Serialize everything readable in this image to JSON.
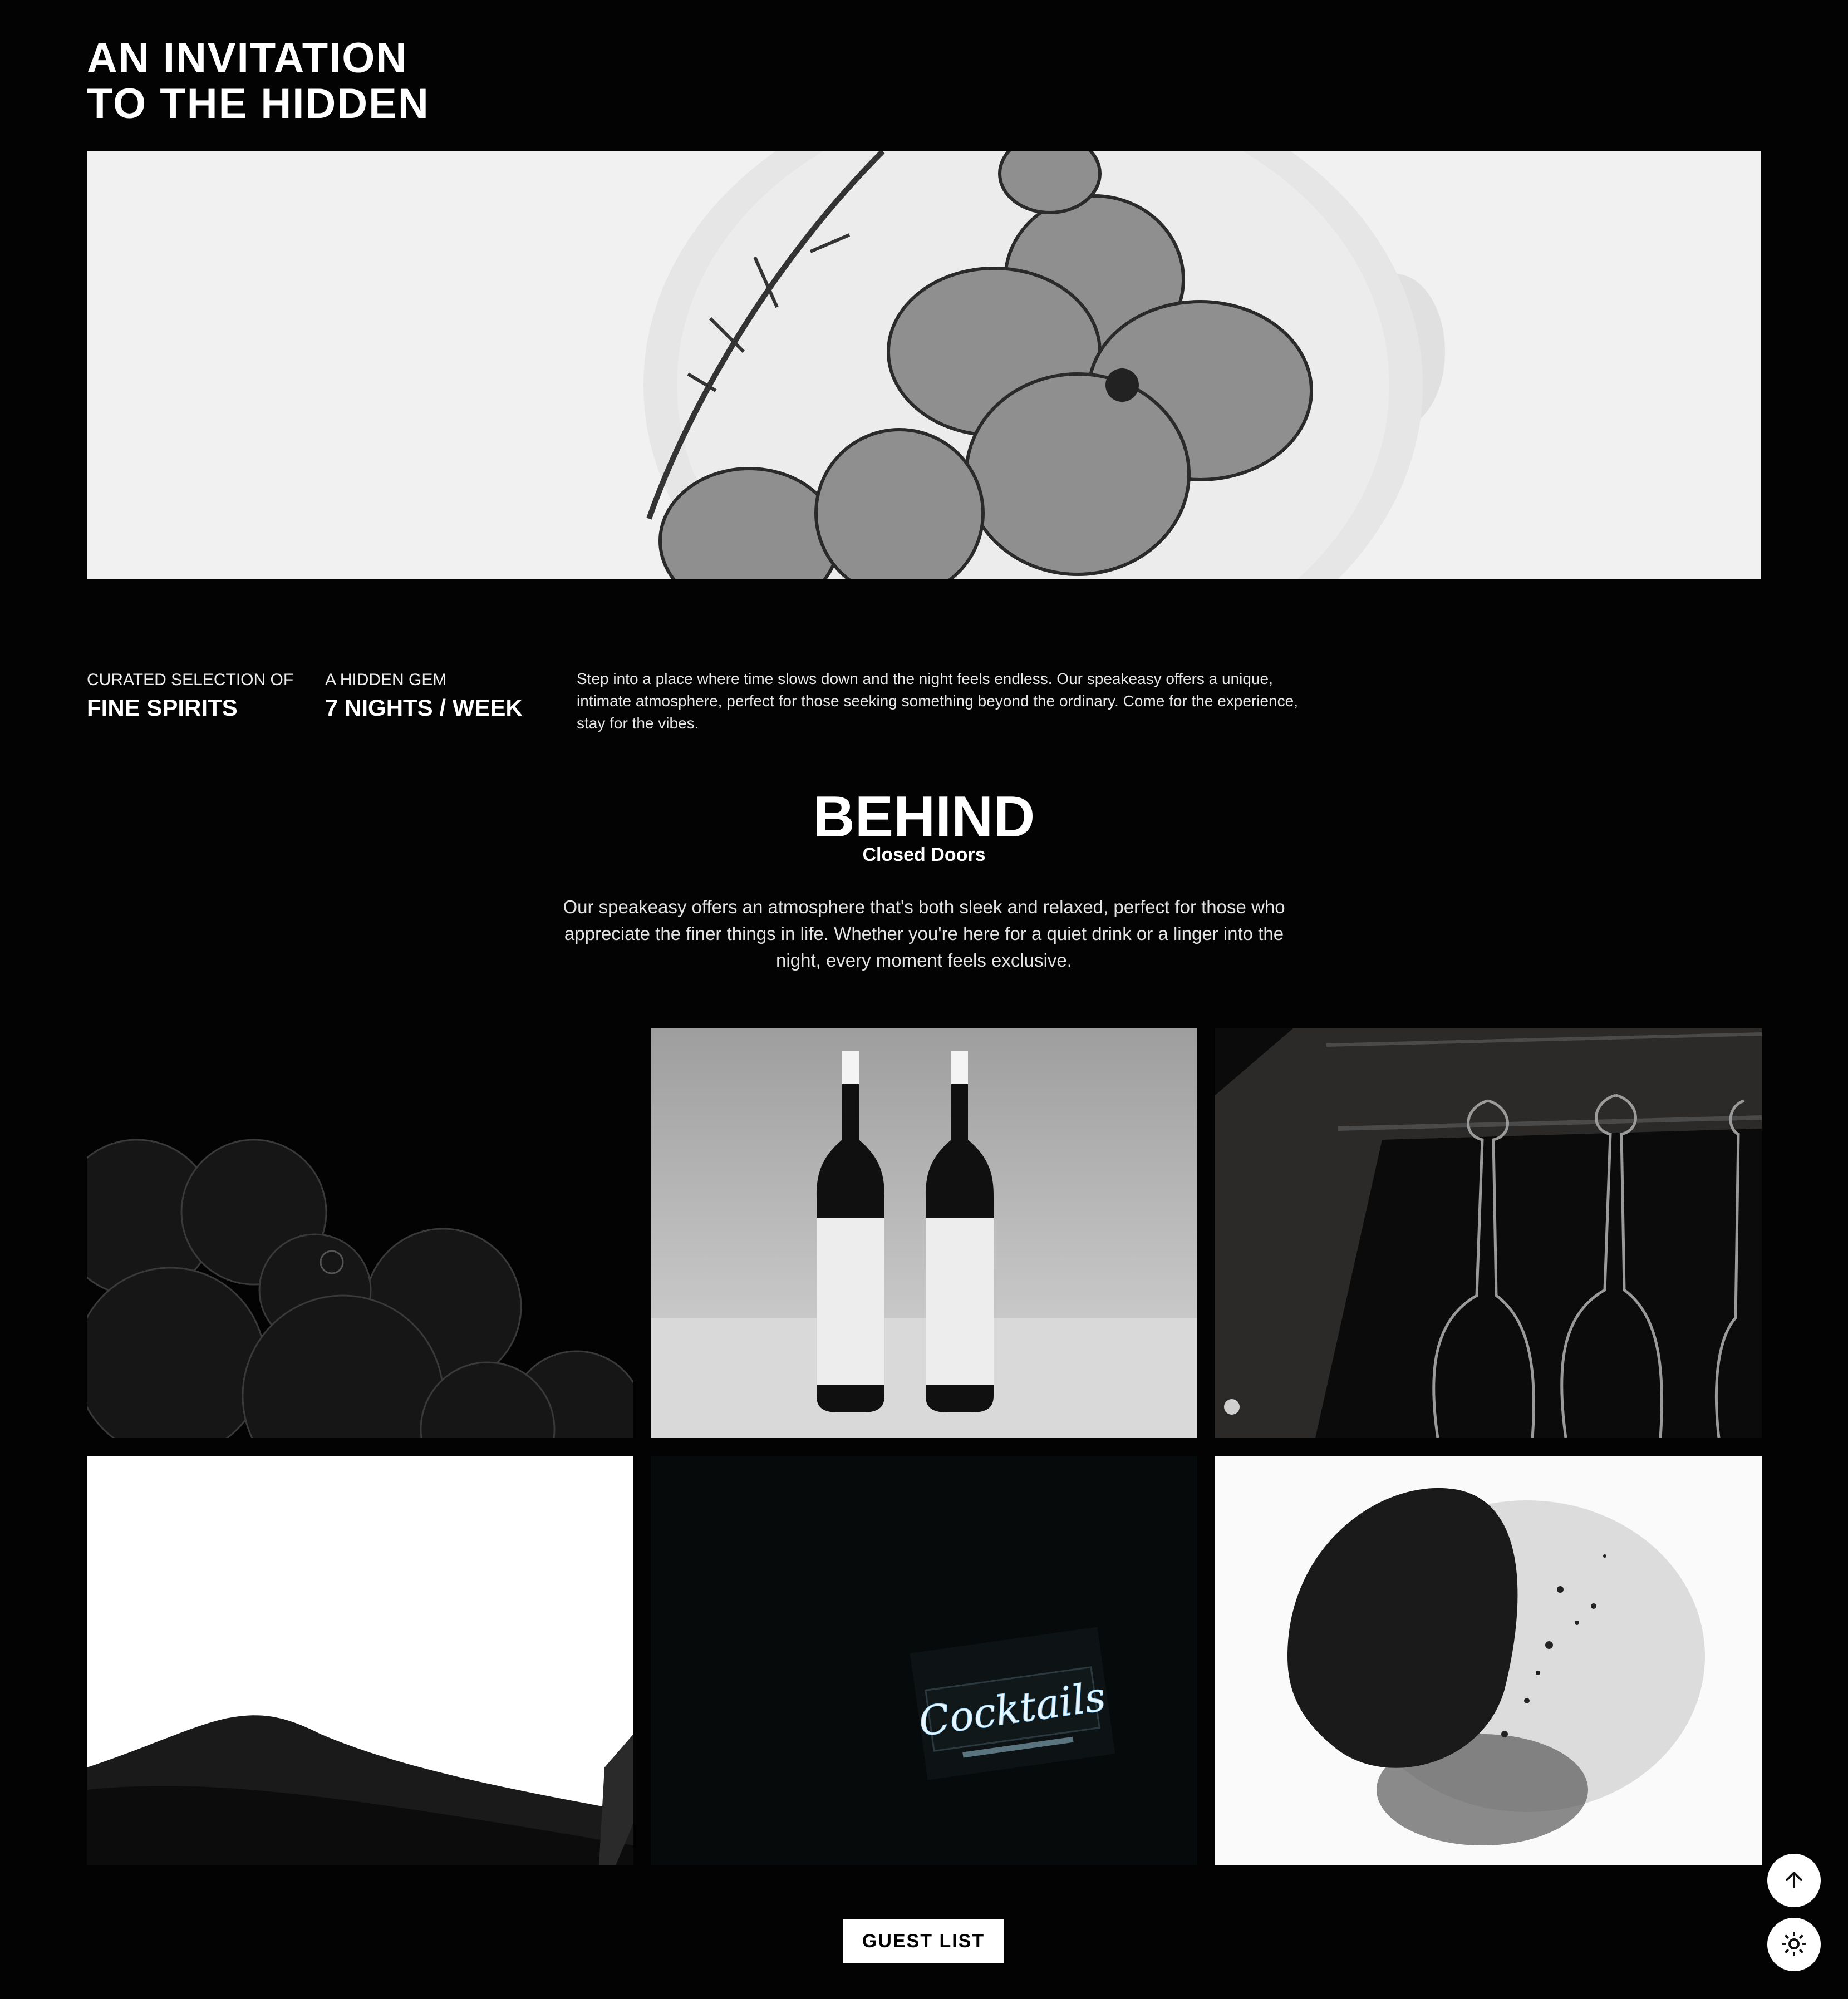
{
  "page": {
    "title_line1": "AN INVITATION",
    "title_line2": "TO THE HIDDEN"
  },
  "hero": {
    "image": "pressed-flowers-in-glass"
  },
  "stats": [
    {
      "label": "CURATED SELECTION OF",
      "value": "FINE SPIRITS"
    },
    {
      "label": "A HIDDEN GEM",
      "value": "7 NIGHTS / WEEK"
    }
  ],
  "intro": "Step into a place where time slows down and the night feels endless. Our speakeasy offers a unique, intimate atmosphere, perfect for those seeking something beyond the ordinary. Come for the experience, stay for the vibes.",
  "behind": {
    "title": "BEHIND",
    "subtitle": "Closed Doors",
    "text": "Our speakeasy offers an atmosphere that's both sleek and relaxed, perfect for those who appreciate the finer things in life. Whether you're here for a quiet drink or a linger into the night, every moment feels exclusive."
  },
  "gallery": [
    {
      "image": "dark-bubbles"
    },
    {
      "image": "two-wine-bottles"
    },
    {
      "image": "hanging-wine-glasses"
    },
    {
      "image": "liquid-surface"
    },
    {
      "image": "neon-sign",
      "sign_text": "Cocktails"
    },
    {
      "image": "ink-stone"
    }
  ],
  "cta": {
    "label": "GUEST LIST"
  },
  "controls": {
    "scroll_top_icon": "arrow-up-icon",
    "theme_icon": "sun-icon"
  },
  "colors": {
    "background": "#030303",
    "text": "#ffffff",
    "button_bg": "#ffffff",
    "button_text": "#000000"
  }
}
